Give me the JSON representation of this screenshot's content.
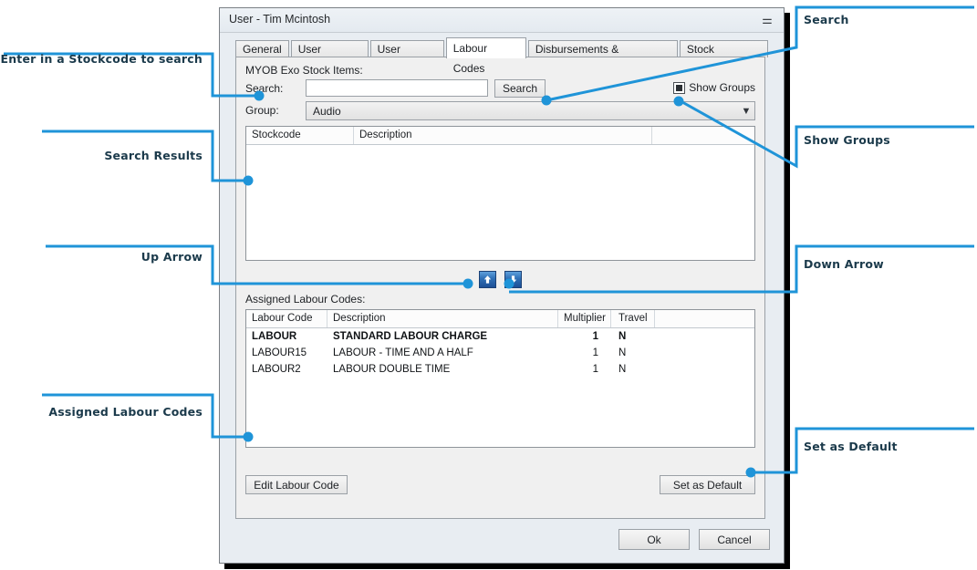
{
  "window": {
    "title": "User  -  Tim Mcintosh",
    "close_icon": "close-icon"
  },
  "tabs": [
    {
      "label": "General",
      "active": false
    },
    {
      "label": "User Settings",
      "active": false
    },
    {
      "label": "User Groups",
      "active": false
    },
    {
      "label": "Labour Codes",
      "active": true
    },
    {
      "label": "Disbursements & Allowances",
      "active": false
    },
    {
      "label": "Stock Locations",
      "active": false
    }
  ],
  "stock_section": {
    "heading": "MYOB Exo Stock Items:",
    "search_label": "Search:",
    "search_value": "",
    "search_placeholder": "",
    "search_button": "Search",
    "show_groups_label": "Show Groups",
    "show_groups_checked": true,
    "group_label": "Group:",
    "group_value": "Audio",
    "group_caret": "chevron-down-icon"
  },
  "results_grid": {
    "columns": [
      "Stockcode",
      "Description",
      ""
    ],
    "rows": []
  },
  "move_buttons": {
    "up": "up-arrow-icon",
    "down": "down-arrow-icon"
  },
  "assigned_section": {
    "heading": "Assigned Labour Codes:",
    "columns": [
      "Labour Code",
      "Description",
      "Multiplier",
      "Travel",
      ""
    ],
    "rows": [
      {
        "code": "LABOUR",
        "description": "STANDARD LABOUR CHARGE",
        "multiplier": "1",
        "travel": "N",
        "is_default": true
      },
      {
        "code": "LABOUR15",
        "description": "LABOUR - TIME AND A HALF",
        "multiplier": "1",
        "travel": "N",
        "is_default": false
      },
      {
        "code": "LABOUR2",
        "description": "LABOUR DOUBLE TIME",
        "multiplier": "1",
        "travel": "N",
        "is_default": false
      }
    ],
    "edit_button": "Edit Labour Code",
    "set_default_button": "Set as Default"
  },
  "footer": {
    "ok": "Ok",
    "cancel": "Cancel"
  },
  "annotations": {
    "stockcode_search": "Enter in a Stockcode to search",
    "search_results": "Search Results",
    "up_arrow": "Up Arrow",
    "assigned_labour_codes": "Assigned Labour Codes",
    "search": "Search",
    "show_groups": "Show Groups",
    "down_arrow": "Down Arrow",
    "set_as_default": "Set as Default"
  },
  "colors": {
    "accent": "#1f94d8",
    "label_text": "#1b3a4b",
    "window_bg": "#e8edf2",
    "panel_bg": "#f0f0f0",
    "move_button": "#2f6fb5"
  }
}
